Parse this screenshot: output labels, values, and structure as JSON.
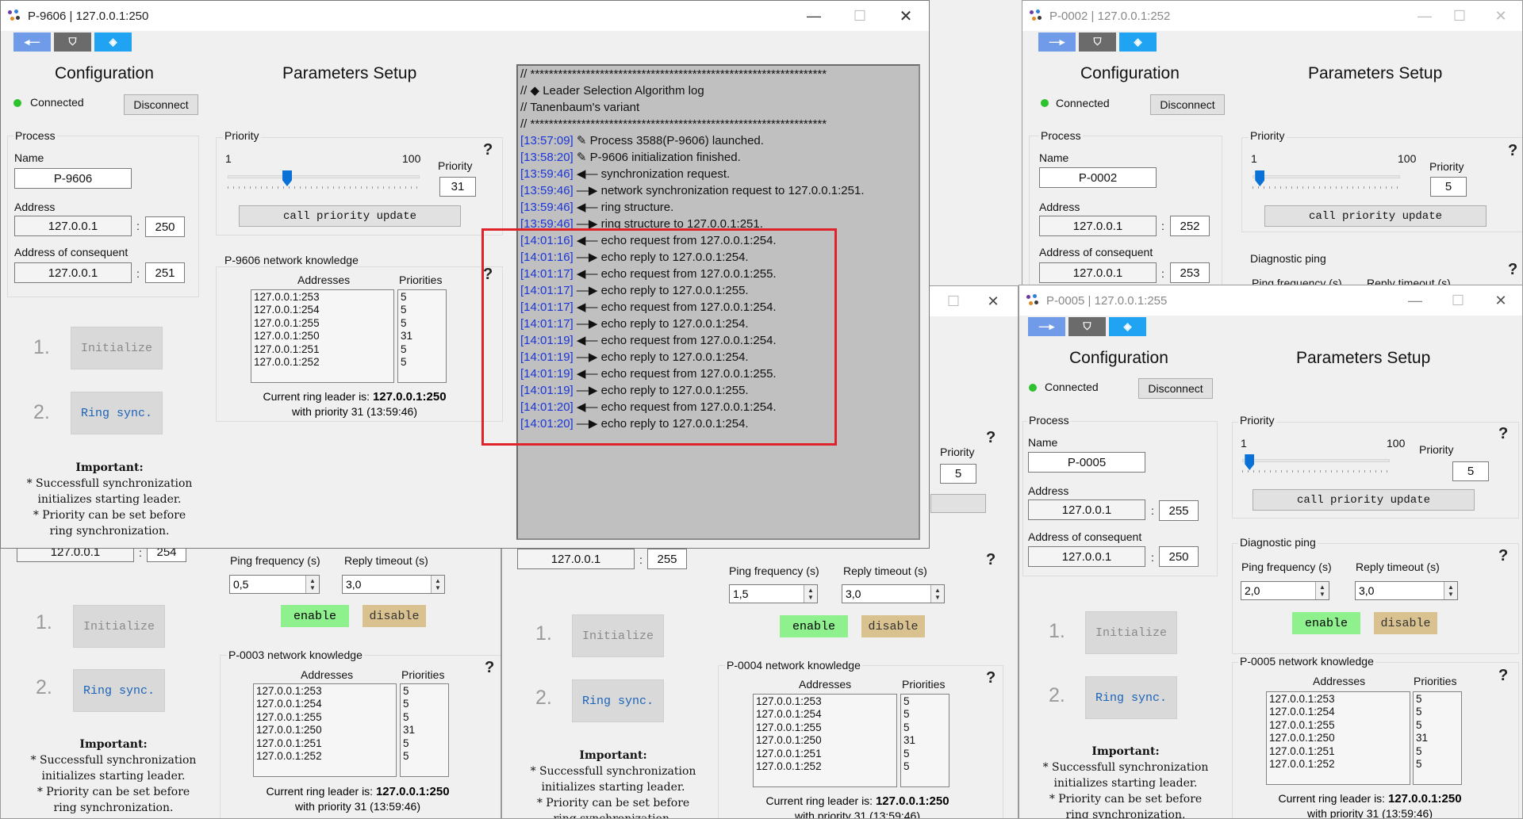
{
  "colors": {
    "connected": "#2ec22e",
    "enable": "#8ef18e",
    "disable": "#d9c28f",
    "timestamp": "#1a35d8",
    "highlight": "#e0232b",
    "toolbar_blue": "#6f9be8",
    "toolbar_gray": "#6b6b6b",
    "toolbar_cyan": "#1fa3f2"
  },
  "icons": {
    "toolbar": [
      "back-arrow-icon",
      "shield-icon",
      "diamond-icon"
    ],
    "title": "app-icon"
  },
  "common": {
    "configuration": "Configuration",
    "parameters_setup": "Parameters Setup",
    "connected": "Connected",
    "disconnect": "Disconnect",
    "process": "Process",
    "name": "Name",
    "address": "Address",
    "address_consequent": "Address of consequent",
    "colon": ":",
    "priority": "Priority",
    "slider_min": "1",
    "slider_max": "100",
    "call_priority_update": "call priority update",
    "diagnostic_ping": "Diagnostic ping",
    "ping_frequency": "Ping frequency (s)",
    "reply_timeout": "Reply timeout (s)",
    "enable": "enable",
    "disable": "disable",
    "addresses": "Addresses",
    "priorities": "Priorities",
    "step1": "1.",
    "step2": "2.",
    "initialize": "Initialize",
    "ring_sync": "Ring sync.",
    "important_title": "Important:",
    "important_l1": "* Successfull synchronization",
    "important_l2": "initializes starting leader.",
    "important_l3": "* Priority can be set before",
    "important_l4": "ring synchronization.",
    "current_leader_label": "Current ring leader is:",
    "leader_value": "127.0.0.1:250",
    "leader_priority": "with priority 31 (13:59:46)",
    "help": "?",
    "min": "—",
    "max": "☐",
    "close": "✕",
    "tb_back": "◂—",
    "tb_fwd": "—▸",
    "tb_shield": "⛉",
    "tb_diamond": "◈"
  },
  "knowledge": {
    "addresses": [
      "127.0.0.1:253",
      "127.0.0.1:254",
      "127.0.0.1:255",
      "127.0.0.1:250",
      "127.0.0.1:251",
      "127.0.0.1:252"
    ],
    "priorities": [
      "5",
      "5",
      "5",
      "31",
      "5",
      "5"
    ]
  },
  "windows": {
    "w9606": {
      "title": "P-9606 | 127.0.0.1:250",
      "name": "P-9606",
      "address": "127.0.0.1",
      "port": "250",
      "consequent": "127.0.0.1",
      "consequent_port": "251",
      "priority": "31",
      "priority_fraction": 0.31,
      "knowledge_title": "P-9606 network knowledge"
    },
    "w0003": {
      "consequent": "127.0.0.1",
      "consequent_port": "254",
      "ping_freq": "0,5",
      "reply_timeout": "3,0",
      "knowledge_title": "P-0003 network knowledge"
    },
    "w0004": {
      "consequent": "127.0.0.1",
      "consequent_port": "255",
      "priority": "5",
      "ping_freq": "1,5",
      "reply_timeout": "3,0",
      "knowledge_title": "P-0004 network knowledge"
    },
    "w0002": {
      "title": "P-0002 | 127.0.0.1:252",
      "name": "P-0002",
      "address": "127.0.0.1",
      "port": "252",
      "consequent": "127.0.0.1",
      "consequent_port": "253",
      "priority": "5",
      "priority_fraction": 0.05,
      "ping_freq_cut": "Ping frequency (s)",
      "reply_timeout_cut": "Reply timeout (s)"
    },
    "w0005": {
      "title": "P-0005 | 127.0.0.1:255",
      "name": "P-0005",
      "address": "127.0.0.1",
      "port": "255",
      "consequent": "127.0.0.1",
      "consequent_port": "250",
      "priority": "5",
      "priority_fraction": 0.05,
      "ping_freq": "2,0",
      "reply_timeout": "3,0",
      "knowledge_title": "P-0005 network knowledge"
    }
  },
  "log": {
    "lines": [
      {
        "ts": "",
        "text": "// ****************************************************************"
      },
      {
        "ts": "",
        "text": "// ◆ Leader Selection Algorithm log"
      },
      {
        "ts": "",
        "text": "// Tanenbaum's variant"
      },
      {
        "ts": "",
        "text": "// ****************************************************************"
      },
      {
        "ts": "[13:57:09]",
        "text": " ✎ Process 3588(P-9606) launched."
      },
      {
        "ts": "[13:58:20]",
        "text": " ✎ P-9606 initialization finished."
      },
      {
        "ts": "[13:59:46]",
        "text": " ◀— synchronization request."
      },
      {
        "ts": "[13:59:46]",
        "text": " —▶ network synchronization request to 127.0.0.1:251."
      },
      {
        "ts": "[13:59:46]",
        "text": " ◀— ring structure."
      },
      {
        "ts": "[13:59:46]",
        "text": " —▶ ring structure to 127.0.0.1:251."
      },
      {
        "ts": "[14:01:16]",
        "text": " ◀— echo request from 127.0.0.1:254."
      },
      {
        "ts": "[14:01:16]",
        "text": " —▶ echo reply to 127.0.0.1:254."
      },
      {
        "ts": "[14:01:17]",
        "text": " ◀— echo request from 127.0.0.1:255."
      },
      {
        "ts": "[14:01:17]",
        "text": " —▶ echo reply to 127.0.0.1:255."
      },
      {
        "ts": "[14:01:17]",
        "text": " ◀— echo request from 127.0.0.1:254."
      },
      {
        "ts": "[14:01:17]",
        "text": " —▶ echo reply to 127.0.0.1:254."
      },
      {
        "ts": "[14:01:19]",
        "text": " ◀— echo request from 127.0.0.1:254."
      },
      {
        "ts": "[14:01:19]",
        "text": " —▶ echo reply to 127.0.0.1:254."
      },
      {
        "ts": "[14:01:19]",
        "text": " ◀— echo request from 127.0.0.1:255."
      },
      {
        "ts": "[14:01:19]",
        "text": " —▶ echo reply to 127.0.0.1:255."
      },
      {
        "ts": "[14:01:20]",
        "text": " ◀— echo request from 127.0.0.1:254."
      },
      {
        "ts": "[14:01:20]",
        "text": " —▶ echo reply to 127.0.0.1:254."
      }
    ]
  }
}
